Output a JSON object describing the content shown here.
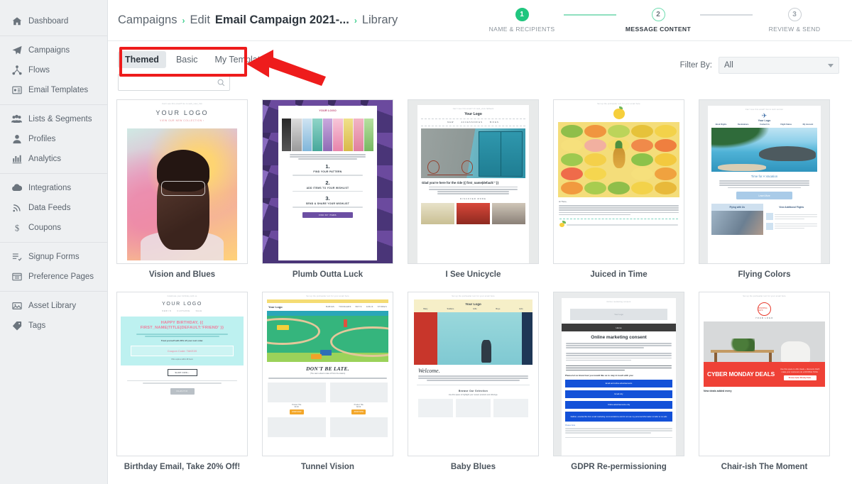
{
  "sidebar": {
    "groups": [
      {
        "items": [
          {
            "label": "Dashboard",
            "icon": "home-icon"
          }
        ]
      },
      {
        "items": [
          {
            "label": "Campaigns",
            "icon": "paper-plane-icon"
          },
          {
            "label": "Flows",
            "icon": "flows-icon"
          },
          {
            "label": "Email Templates",
            "icon": "email-template-icon"
          }
        ]
      },
      {
        "items": [
          {
            "label": "Lists & Segments",
            "icon": "users-icon"
          },
          {
            "label": "Profiles",
            "icon": "person-icon"
          },
          {
            "label": "Analytics",
            "icon": "bar-chart-icon"
          }
        ]
      },
      {
        "items": [
          {
            "label": "Integrations",
            "icon": "cloud-icon"
          },
          {
            "label": "Data Feeds",
            "icon": "rss-icon"
          },
          {
            "label": "Coupons",
            "icon": "dollar-icon"
          }
        ]
      },
      {
        "items": [
          {
            "label": "Signup Forms",
            "icon": "list-check-icon"
          },
          {
            "label": "Preference Pages",
            "icon": "window-icon"
          }
        ]
      },
      {
        "items": [
          {
            "label": "Asset Library",
            "icon": "image-icon"
          },
          {
            "label": "Tags",
            "icon": "tag-icon"
          }
        ]
      }
    ]
  },
  "breadcrumb": {
    "root": "Campaigns",
    "sep": "›",
    "edit": "Edit",
    "campaign": "Email Campaign 2021-...",
    "current": "Library"
  },
  "steps": [
    {
      "number": "1",
      "label": "NAME & RECIPIENTS",
      "state": "done"
    },
    {
      "number": "2",
      "label": "MESSAGE CONTENT",
      "state": "active"
    },
    {
      "number": "3",
      "label": "REVIEW & SEND",
      "state": "pending"
    }
  ],
  "tabs": [
    {
      "label": "Themed",
      "selected": true
    },
    {
      "label": "Basic",
      "selected": false
    },
    {
      "label": "My Templates",
      "selected": false
    }
  ],
  "search": {
    "value": "",
    "placeholder": ""
  },
  "filter": {
    "label": "Filter By:",
    "value": "All"
  },
  "colors": {
    "accent_green": "#21c67f",
    "annotation_red": "#ee1c1c",
    "sidebar_bg": "#eef0f2",
    "tab_selected_bg": "#e3e7ea"
  },
  "templates": [
    {
      "name": "Vision and Blues",
      "preheader": "Can't see this email? Go to web_view_link",
      "logo": "YOUR LOGO",
      "cta": "VIEW OUR NEW COLLECTION ›"
    },
    {
      "name": "Plumb Outta Luck",
      "logo": "YOUR LOGO",
      "intro": "The moment a customer signs up for your newsletter is a special one. Use this space to welcome them to the brand and turn first time subscribers into long term customers.",
      "steps": [
        {
          "num": "1.",
          "head": "FIND YOUR PATTERN",
          "sub": "Use this space to highlight your newest products and offerings."
        },
        {
          "num": "2.",
          "head": "ADD ITEMS TO YOUR WISHLIST",
          "sub": "Use this space to highlight your newest products and offerings."
        },
        {
          "num": "3.",
          "head": "SEND & SHARE YOUR WISHLIST",
          "sub": "Use this space to highlight your newest products and offerings."
        }
      ],
      "cta": "FIND MY ITEMS"
    },
    {
      "name": "I See Unicycle",
      "preheader": "Can't see this email? Or web_view fallback",
      "logo": "Your Logo",
      "nav": [
        "NEW",
        "ACCESSORIES",
        "BIKES"
      ],
      "headline": "Glad you're here for the ride {{ first_name|default:'' }}",
      "body": "The moment a customer signs up for your newsletter is a special one. Use this space to welcome them to the brand and turn first time subscribers into long term customers.",
      "body2": "Use this space below to highlight your newest products and offerings.",
      "cta": "DISCOVER MORE"
    },
    {
      "name": "Juiced in Time",
      "preheader": "Set up the preheader text for your email here",
      "greeting": "Hi There,",
      "body": "This is where you can put your most important content. The thing you don't want any one to miss. Maybe you need to link to something. Whether it's an important announcement, new products or services, or letting people know about a special promotion. With Klaviyo, you're covered. Happy emailing!"
    },
    {
      "name": "Flying Colors",
      "preheader": "Can't see this email? Go to web version",
      "logo": "Your Logo",
      "nav": [
        "Book Flights",
        "Destinations",
        "Contact Us",
        "Flight Status",
        "My Account"
      ],
      "headline": "Time for A Vacation",
      "body": "This is where you can put your most important content. The thing you don't want any one to miss. Maybe you need to link to something. Whether it's an important announcement, new products, or services or letting people know about a special promotion. With Klaviyo, you're covered. Happy emailing!",
      "cta": "Learn More",
      "col_left": "Flying with Us",
      "col_right": "View Additional Flights",
      "col_item": "Let people know why they should buy this product so they know what to expect."
    },
    {
      "name": "Birthday Email, Take 20% Off!",
      "preheader": "Celebrate your birthday with us",
      "logo": "YOUR LOGO",
      "nav": [
        "NEW IN",
        "CLOTHING",
        "SALE"
      ],
      "headline": "HAPPY BIRTHDAY, {{ FIRST_NAME|TITLE|DEFAULT:'FRIEND' }}",
      "body": "We heard that it's your birthday! Do you know what that means? Today is all about YOU :)",
      "body2": "Treat yourself with 20% off your next order.",
      "coupon": "Coupon Code: TAKE20",
      "expiry": "Offer expires within 48 hours",
      "cta": "SHOP NOW ›",
      "brand": "KLAVIYO"
    },
    {
      "name": "Tunnel Vision",
      "preheader": "Set up the preheader text for your email here",
      "logo": "Your Logo",
      "nav": [
        "BABIES",
        "TODDLERS",
        "BOYS",
        "GIRLS",
        "STORES"
      ],
      "headline": "DON'T BE LATE.",
      "subhead": "(The sale's about to take off from the station)",
      "body": "Use this space to offer deals and discounts that will make your customers do a double take.",
      "product_title": "Product Title",
      "product_price": "$0.00",
      "product_cta": "SHOP NOW"
    },
    {
      "name": "Baby Blues",
      "preheader": "Set up the preheader text for your email here",
      "logo": "Your Logo",
      "nav": [
        "Baby",
        "Toddlers",
        "Gifts",
        "Boys",
        "Girls"
      ],
      "headline": "Welcome.",
      "body": "The moment a customer signs up for your newsletter is a special one. Use this space to welcome them to the brand and turn first time subscribers into long term customers.",
      "section": "Browse Our Selection",
      "section_sub": "Use this space to highlight your newest products and offerings."
    },
    {
      "name": "GDPR Re-permissioning",
      "preheader": "Online marketing consent",
      "logo": "Your Logo",
      "navbar": "Home",
      "headline": "Online marketing consent",
      "body1": "Because of recent changes in the law governing online marketing, we are asking you to confirm that you would like to continue receiving information about {{ organization.name }} products and services on email and targeted online advertising.",
      "body2": "We use email and targeted online advertising to send you product and service updates, promotional offers and other marketing communications based on the information we collect about you, such as your email address, general location, and purchase and website browsing history.",
      "body3": "Please respond before May 25, 2018 by clicking the appropriate buttons below. If you do not indicate your marketing preferences before that date, you may miss out on valuable promotional offers from us.",
      "question": "Please let us know how you would like us to stay in touch with you:",
      "options": [
        "Email and online advertisements",
        "Email only",
        "Online advertisements only",
        "Neither, unsubscribe from email marketing communications and do not use my personal information to tailor to me ads"
      ],
      "note_title": "Please Note",
      "note": "We will continue to send you transactional communications, such as order and shipping confirmations, as updated in our Terms and Conditions and Privacy Policy. We process your personal data as stated in our Privacy Policy. Read our privacy policy here.",
      "note2": "You may withdraw your consent or manage your preferences at any time by clicking the"
    },
    {
      "name": "Chair-ish The Moment",
      "preheader": "Set up the preheader text for your email here",
      "logo": "YOUR LOGO",
      "logo_mark": "SHOPPING DAYS",
      "headline": "CYBER MONDAY DEALS",
      "body": "Use this space to offer deals + discounts that'll make your customers do a DOUBLE TAKE.",
      "cta": "Browse Cyber Monday Deals",
      "footer": "New deals added every"
    }
  ]
}
